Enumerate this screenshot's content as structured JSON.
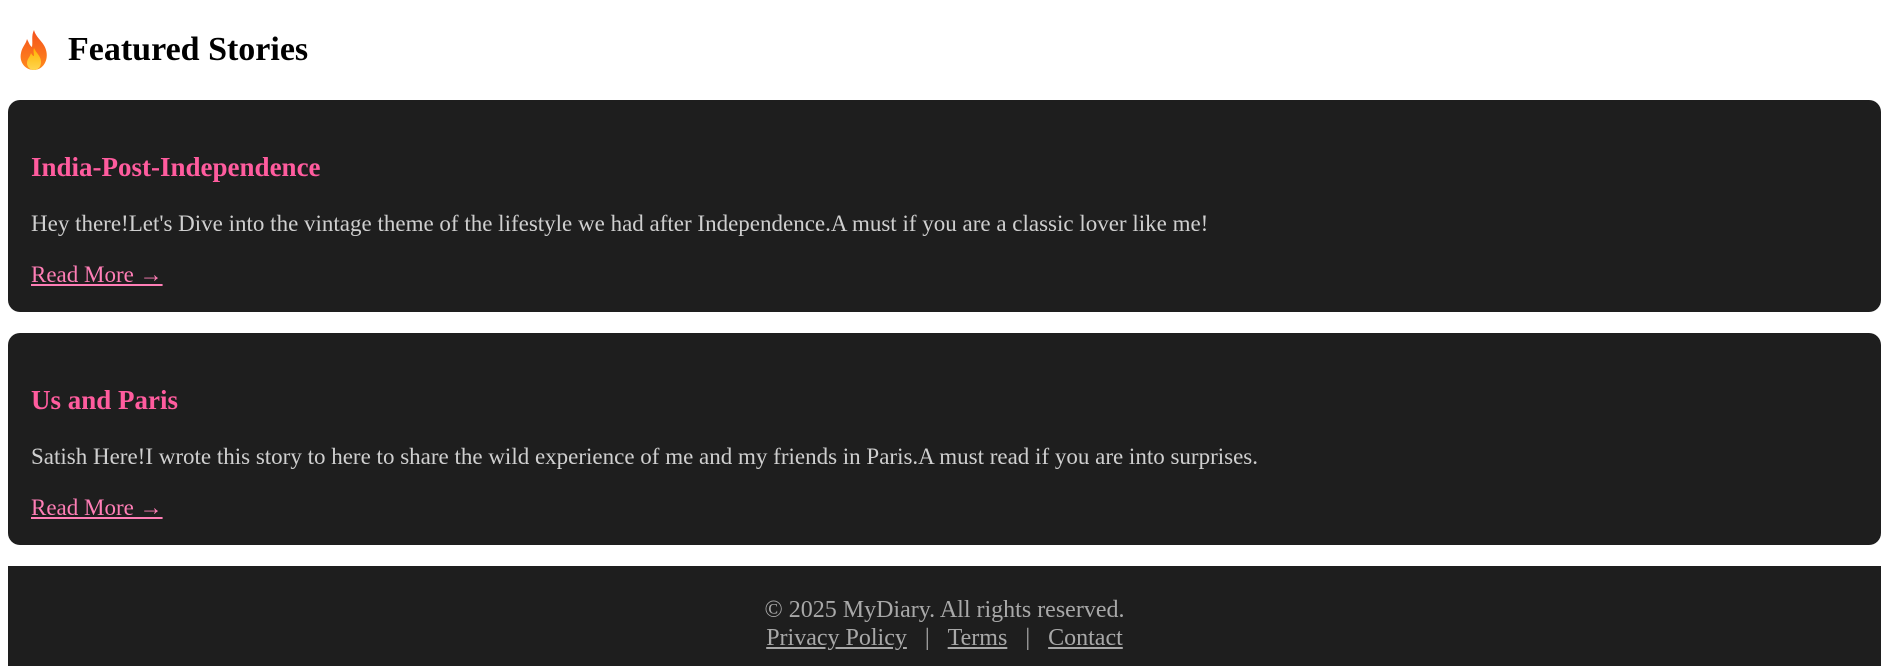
{
  "header": {
    "icon": "fire-icon",
    "title": "Featured Stories"
  },
  "stories": [
    {
      "title": "India-Post-Independence",
      "description": "Hey there!Let's Dive into the vintage theme of the lifestyle we had after Independence.A must if you are a classic lover like me!",
      "link_label": "Read More →"
    },
    {
      "title": "Us and Paris",
      "description": "Satish Here!I wrote this story to here to share the wild experience of me and my friends in Paris.A must read if you are into surprises.",
      "link_label": "Read More →"
    }
  ],
  "footer": {
    "copyright": "© 2025 MyDiary. All rights reserved.",
    "links": [
      "Privacy Policy",
      "Terms",
      "Contact"
    ],
    "separator": "|"
  },
  "colors": {
    "card_background": "#1e1e1e",
    "story_title": "#ff5c9e",
    "link": "#ff7eb6",
    "body_text": "#cfcfcf",
    "footer_text": "#a8a8a8"
  }
}
